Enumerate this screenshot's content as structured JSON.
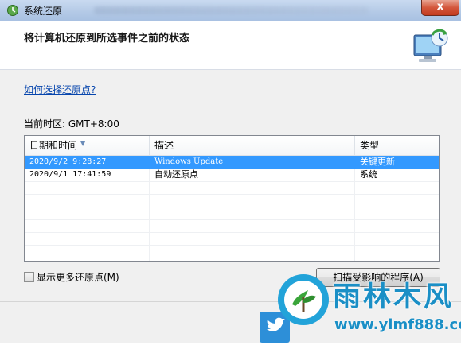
{
  "window": {
    "title": "系统还原",
    "close_label": "x"
  },
  "header": {
    "heading": "将计算机还原到所选事件之前的状态"
  },
  "main": {
    "help_link": "如何选择还原点?",
    "timezone": "当前时区: GMT+8:00",
    "columns": [
      "日期和时间",
      "描述",
      "类型"
    ],
    "rows": [
      {
        "datetime": "2020/9/2 9:28:27",
        "description": "Windows Update",
        "type": "关键更新",
        "selected": true
      },
      {
        "datetime": "2020/9/1 17:41:59",
        "description": "自动还原点",
        "type": "系统",
        "selected": false
      }
    ],
    "show_more_label": "显示更多还原点(M)",
    "show_more_checked": false,
    "scan_button_label": "扫描受影响的程序(A)"
  },
  "watermark": {
    "title": "雨林木风",
    "url": "www.ylmf888.com"
  },
  "colors": {
    "selection": "#3399ff",
    "link": "#0645ad",
    "watermark": "#1a8fc6"
  }
}
